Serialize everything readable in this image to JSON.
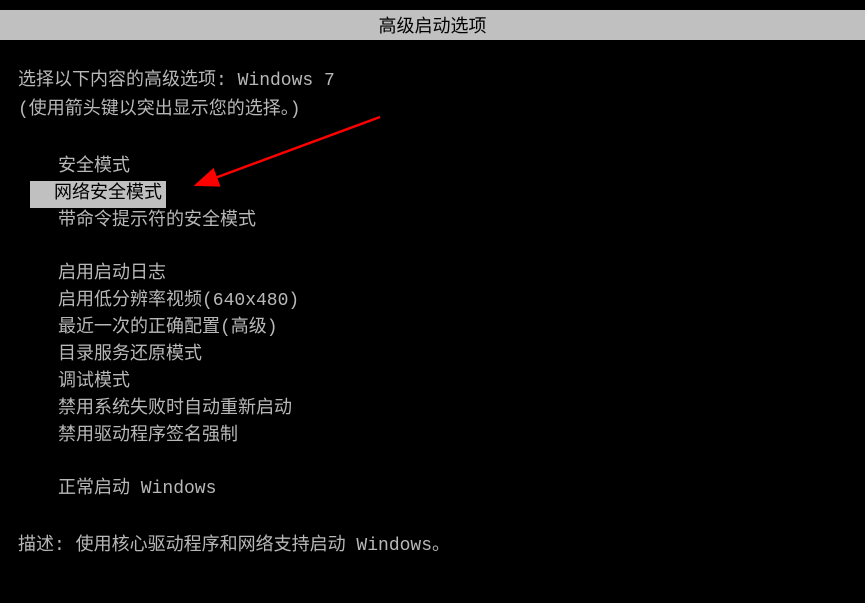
{
  "title": "高级启动选项",
  "instruction1": "选择以下内容的高级选项: Windows 7",
  "instruction2": "(使用箭头键以突出显示您的选择。)",
  "options": {
    "safe_mode": "安全模式",
    "safe_mode_networking": "网络安全模式",
    "safe_mode_cmd": "带命令提示符的安全模式",
    "enable_boot_log": "启用启动日志",
    "low_res_video": "启用低分辨率视频(640x480)",
    "last_known_good": "最近一次的正确配置(高级)",
    "ds_restore": "目录服务还原模式",
    "debug_mode": "调试模式",
    "disable_auto_restart": "禁用系统失败时自动重新启动",
    "disable_driver_sig": "禁用驱动程序签名强制",
    "start_normally": "正常启动 Windows"
  },
  "description_label": "描述:",
  "description_text": "使用核心驱动程序和网络支持启动 Windows。"
}
